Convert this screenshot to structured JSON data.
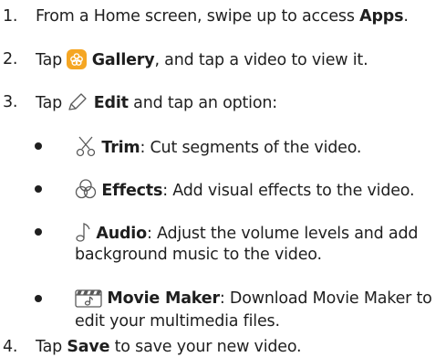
{
  "steps": [
    {
      "number": "1.",
      "pre": "From a Home screen, swipe up to access ",
      "bold": "Apps",
      "post": "."
    },
    {
      "number": "2.",
      "pre": "Tap ",
      "icon": "gallery-icon",
      "bold": "Gallery",
      "post": ", and tap a video to view it."
    },
    {
      "number": "3.",
      "pre": "Tap ",
      "icon": "edit-pencil-icon",
      "bold": "Edit",
      "post": " and tap an option:"
    },
    {
      "number": "4.",
      "pre": "Tap ",
      "bold": "Save",
      "post": " to save your new video."
    }
  ],
  "options": [
    {
      "icon": "trim-scissors-icon",
      "bold": "Trim",
      "line1": ": Cut segments of the video."
    },
    {
      "icon": "effects-icon",
      "bold": "Effects",
      "line1": ": Add visual effects to the video."
    },
    {
      "icon": "audio-note-icon",
      "bold": "Audio",
      "line1": ": Adjust the volume levels and add",
      "line2": "background music to the video."
    },
    {
      "icon": "movie-maker-icon",
      "bold": "Movie Maker",
      "line1": ": Download Movie Maker to",
      "line2": "edit your multimedia files."
    }
  ],
  "colors": {
    "text": "#1f1f1f",
    "gallery_bg": "#f5a623",
    "icon_line": "#5a5a5a"
  }
}
